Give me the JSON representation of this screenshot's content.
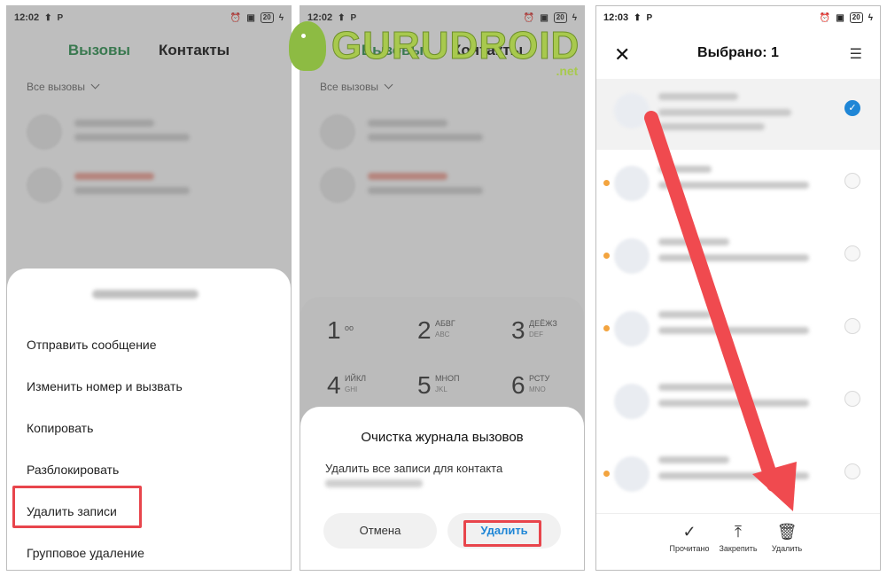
{
  "watermark": {
    "brand": "GURUDROID",
    "domain": ".net"
  },
  "screen1": {
    "status": {
      "time": "12:02",
      "battery": "20"
    },
    "tabs": {
      "calls": "Вызовы",
      "contacts": "Контакты"
    },
    "filter": "Все вызовы",
    "menu": [
      "Отправить сообщение",
      "Изменить номер и вызвать",
      "Копировать",
      "Разблокировать",
      "Удалить записи",
      "Групповое удаление"
    ]
  },
  "screen2": {
    "status": {
      "time": "12:02",
      "battery": "20"
    },
    "tabs": {
      "calls": "Вызовы",
      "contacts": "Контакты"
    },
    "filter": "Все вызовы",
    "keys": [
      {
        "num": "1",
        "letters": "",
        "sub": "oo"
      },
      {
        "num": "2",
        "letters": "АБВГ",
        "sub": "ABC"
      },
      {
        "num": "3",
        "letters": "ДЕЁЖЗ",
        "sub": "DEF"
      },
      {
        "num": "4",
        "letters": "ИЙКЛ",
        "sub": "GHI"
      },
      {
        "num": "5",
        "letters": "МНОП",
        "sub": "JKL"
      },
      {
        "num": "6",
        "letters": "РСТУ",
        "sub": "MNO"
      }
    ],
    "dialog": {
      "title": "Очистка журнала вызовов",
      "text": "Удалить все записи для контакта",
      "cancel": "Отмена",
      "delete": "Удалить"
    }
  },
  "screen3": {
    "status": {
      "time": "12:03",
      "battery": "20"
    },
    "header": {
      "title": "Выбрано: 1"
    },
    "bottom_bar": {
      "read": "Прочитано",
      "pin": "Закрепить",
      "delete": "Удалить"
    }
  },
  "colors": {
    "accent_green": "#2a8a4c",
    "highlight_red": "#e8454c",
    "link_blue": "#1f86d6",
    "arrow_red": "#f04a4f"
  }
}
